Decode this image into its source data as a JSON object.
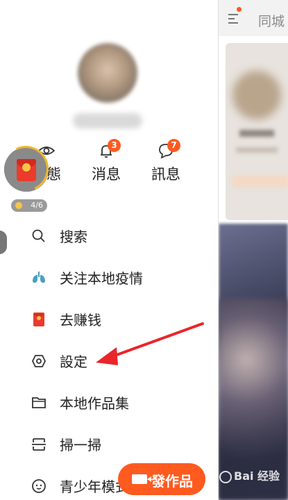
{
  "header": {
    "city_tab": "同城"
  },
  "quick_actions": [
    {
      "label": "動態",
      "icon": "eye-icon"
    },
    {
      "label": "消息",
      "icon": "bell-icon",
      "badge": "3"
    },
    {
      "label": "訊息",
      "icon": "chat-bubble-icon",
      "badge": "7"
    }
  ],
  "red_packet": {
    "progress": "4/6"
  },
  "menu": [
    {
      "label": "搜索",
      "icon": "search-icon"
    },
    {
      "label": "关注本地疫情",
      "icon": "lungs-icon"
    },
    {
      "label": "去赚钱",
      "icon": "red-envelope-icon"
    },
    {
      "label": "設定",
      "icon": "settings-hexagon-icon"
    },
    {
      "label": "本地作品集",
      "icon": "folder-icon"
    },
    {
      "label": "掃一掃",
      "icon": "scan-icon"
    },
    {
      "label": "青少年模式",
      "icon": "teen-face-icon"
    }
  ],
  "publish_button": {
    "label": "發作品"
  },
  "watermark": {
    "text": "Bai 经验"
  },
  "colors": {
    "accent": "#ff5a1f",
    "annotation_arrow": "#e8262b"
  }
}
